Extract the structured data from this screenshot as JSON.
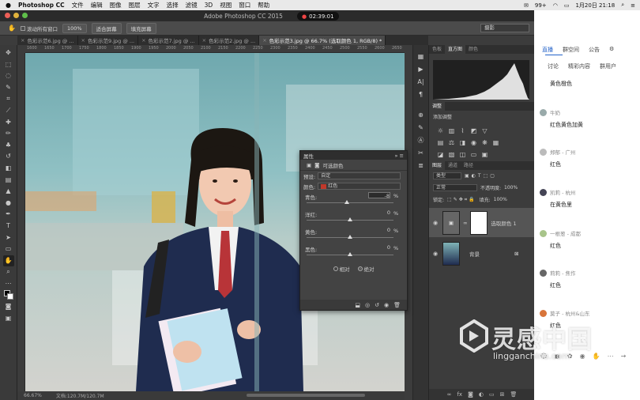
{
  "menubar": {
    "app": "Photoshop CC",
    "items": [
      "文件",
      "编辑",
      "图像",
      "图层",
      "文字",
      "选择",
      "滤镜",
      "3D",
      "视图",
      "窗口",
      "帮助"
    ],
    "battery": "99+",
    "date": "1月20日 21:18"
  },
  "window": {
    "title": "Adobe Photoshop CC 2015",
    "timer": "02:39:01"
  },
  "options": {
    "scroll_all": "滚动所有窗口",
    "zoom": "100%",
    "fit_screen": "适合屏幕",
    "fill_screen": "填充屏幕",
    "workspace": "摄影"
  },
  "doc_tabs": [
    "色彩示范6.jpg @ ...",
    "色彩示范9.jpg @ ...",
    "色彩示范7.jpg @ ...",
    "色彩示范2.jpg @ ...",
    "色彩示范3.jpg @ 66.7% (选取颜色 1, RGB/8) *"
  ],
  "ruler": [
    "1600",
    "1650",
    "1700",
    "1750",
    "1800",
    "1850",
    "1900",
    "1950",
    "2000",
    "2050",
    "2100",
    "2150",
    "2200",
    "2250",
    "2300",
    "2350",
    "2400",
    "2450",
    "2500",
    "2550",
    "2600",
    "2650"
  ],
  "status": {
    "zoom": "66.67%",
    "doc": "文档:120.7M/120.7M"
  },
  "panels": {
    "hist_tabs": [
      "色板",
      "直方图",
      "颜色"
    ],
    "adjust_title": "调整",
    "adjust_add": "添加调整",
    "layer_tabs": [
      "图层",
      "通道",
      "路径"
    ],
    "kind": "类型",
    "blend": "正常",
    "opacity_label": "不透明度:",
    "opacity": "100%",
    "lock_label": "锁定:",
    "fill_label": "填充:",
    "fill": "100%",
    "layers": [
      {
        "name": "选取颜色 1"
      },
      {
        "name": "背景"
      }
    ]
  },
  "properties": {
    "title": "属性",
    "subtitle": "可选颜色",
    "preset_label": "预设:",
    "preset": "自定",
    "color_label": "颜色:",
    "color": "红色",
    "swatch": "#c0392b",
    "sliders": [
      {
        "label": "青色:",
        "value": "-8"
      },
      {
        "label": "洋红:",
        "value": "0"
      },
      {
        "label": "黄色:",
        "value": "0"
      },
      {
        "label": "黑色:",
        "value": "0"
      }
    ],
    "slider_fractions": [
      0.46,
      0.5,
      0.5,
      0.5
    ],
    "unit": "%",
    "relative": "相对",
    "absolute": "绝对"
  },
  "chat": {
    "tabs1": [
      "直播",
      "群空间",
      "公告"
    ],
    "tabs2": [
      "讨论",
      "精彩内容",
      "群用户"
    ],
    "messages": [
      {
        "user": "",
        "text": "黄色橙色"
      },
      {
        "user": "牛奶",
        "text": "红色黄色加黄"
      },
      {
        "user": "郑郁 - 广州",
        "text": "红色"
      },
      {
        "user": "凯莉 - 杭州",
        "text": "在黄色里"
      },
      {
        "user": "一根葱 - 成都",
        "text": "红色"
      },
      {
        "user": "莉莉 - 焦作",
        "text": "红色"
      },
      {
        "user": "莫子 - 杭州&山东",
        "text": "红色"
      }
    ]
  },
  "watermark": {
    "cn": "灵感中国",
    "url": "lingganchina.com"
  }
}
